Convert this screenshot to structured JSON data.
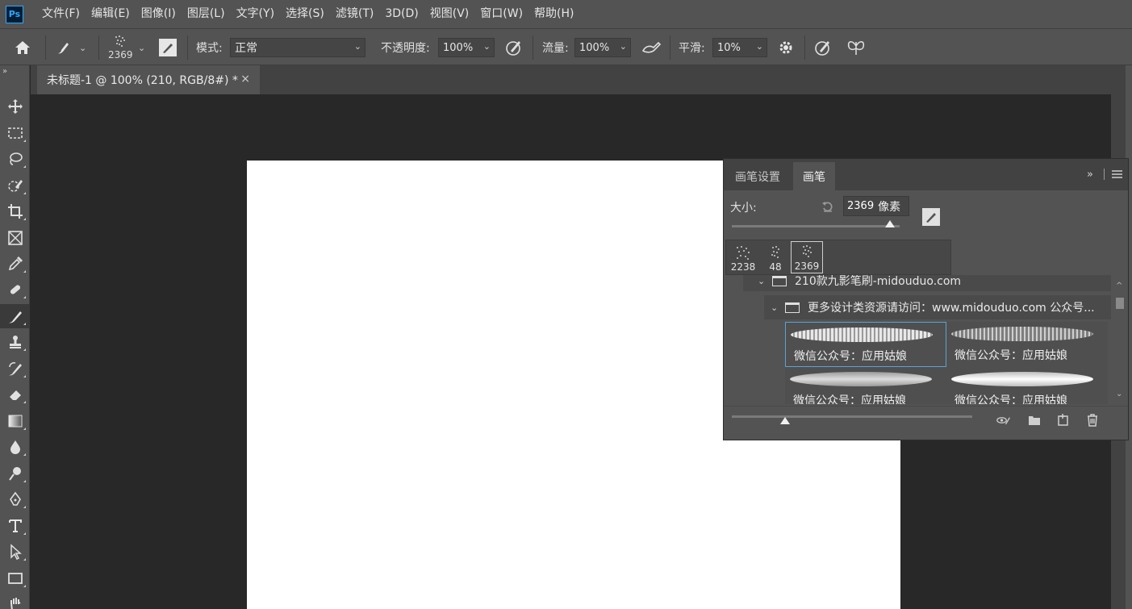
{
  "app": {
    "logo_text": "Ps"
  },
  "menu": [
    "文件(F)",
    "编辑(E)",
    "图像(I)",
    "图层(L)",
    "文字(Y)",
    "选择(S)",
    "滤镜(T)",
    "3D(D)",
    "视图(V)",
    "窗口(W)",
    "帮助(H)"
  ],
  "options": {
    "brush_size": "2369",
    "mode_label": "模式:",
    "mode_value": "正常",
    "opacity_label": "不透明度:",
    "opacity_value": "100%",
    "flow_label": "流量:",
    "flow_value": "100%",
    "smoothing_label": "平滑:",
    "smoothing_value": "10%"
  },
  "document": {
    "tab_title": "未标题-1 @ 100% (210, RGB/8#) *",
    "close_glyph": "×"
  },
  "brush_panel": {
    "tabs": [
      "画笔设置",
      "画笔"
    ],
    "active_tab": 1,
    "expand_glyph": "»",
    "size_label": "大小:",
    "size_value": "2369",
    "size_unit": "像素",
    "size_slider_fraction": 0.94,
    "recent_brushes": [
      "2238",
      "48",
      "2369"
    ],
    "group_name": "210款九影笔刷-midouduo.com",
    "subgroup_name": "更多设计类资源请访问：www.midouduo.com 公众号...",
    "brush_items": [
      "微信公众号：应用姑娘",
      "微信公众号：应用姑娘",
      "微信公众号：应用姑娘",
      "微信公众号：应用姑娘"
    ],
    "preview_slider_fraction": 0.22
  },
  "colors": {
    "ui_background": "#535353",
    "canvas_background": "#282828",
    "document": "#ffffff",
    "selection_accent": "#5aa3d6"
  }
}
